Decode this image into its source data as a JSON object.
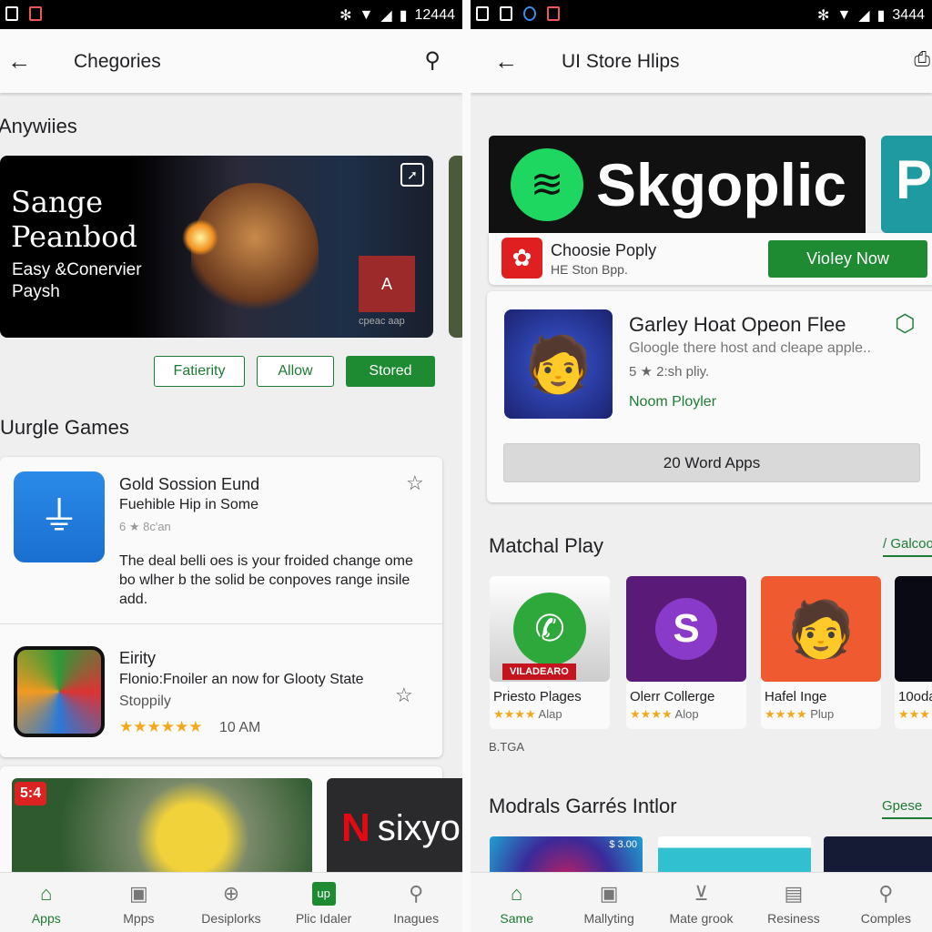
{
  "left": {
    "status": {
      "time": "12444"
    },
    "appbar": {
      "title": "Chegories"
    },
    "section1": {
      "title": "Anywiies"
    },
    "banner": {
      "title_line1": "Sange",
      "title_line2": "Peanbod",
      "subtitle_line1": "Easy &Conervier",
      "subtitle_line2": "Paysh",
      "badge_caption": "cpeac aap",
      "badge_text": "A"
    },
    "chips": [
      "Fatierity",
      "Allow",
      "Stored"
    ],
    "section2": {
      "title": "Uurgle Games"
    },
    "apps": [
      {
        "name": "Gold Sossion Eund",
        "subtitle": "Fuehible Hip in Some",
        "meta": "6 ★ 8c'an",
        "description": "The deal belli oes is your froided change ome bo wlher b the solid be conpoves range insile add."
      },
      {
        "name": "Eirity",
        "subtitle": "Flonio:Fnoiler an now for Glooty State",
        "meta": "Stoppily",
        "rating": "★★★★★★",
        "time": "10 AM"
      }
    ],
    "promos": [
      {
        "badge": "5:4"
      },
      {
        "logo": "N",
        "text": "sixyo"
      }
    ],
    "nav": [
      "Apps",
      "Mpps",
      "Desiplorks",
      "Plic Idaler",
      "Inagues"
    ]
  },
  "right": {
    "status": {
      "time": "3444"
    },
    "appbar": {
      "title": "UI Store Hlips"
    },
    "hero": {
      "brand": "Skgoplic",
      "next_letter": "P"
    },
    "featured": {
      "name": "Choosie Poply",
      "sub": "HE Ston Bpp.",
      "cta": "VioIey Now"
    },
    "app_card": {
      "name": "Garley Hoat Opeon Flee",
      "desc": "Gloogle there host and cleape apple..",
      "meta": "5 ★ 2:sh pliy.",
      "developer": "Noom Ployler",
      "button": "20 Word Apps"
    },
    "section1": {
      "title": "Matchal Play",
      "link": "/ Galcoo"
    },
    "tiles": [
      {
        "name": "Priesto Plages",
        "rating": "★★★★",
        "tag": "Alap",
        "banner": "VILADEARO"
      },
      {
        "name": "Olerr Collerge",
        "rating": "★★★★",
        "tag": "Alop"
      },
      {
        "name": "Hafel Inge",
        "rating": "★★★★",
        "tag": "Plup"
      },
      {
        "name": "10oda",
        "rating": "★★★",
        "tag": ""
      }
    ],
    "footnote": "B.TGA",
    "section2": {
      "title": "Modrals Garrés Intlor",
      "link": "Gpese"
    },
    "promo_price": "$ 3.00",
    "nav": [
      "Same",
      "Mallyting",
      "Mate grook",
      "Resiness",
      "Comples"
    ]
  },
  "colors": {
    "accent": "#1e8a32",
    "spotify": "#1ed760"
  }
}
